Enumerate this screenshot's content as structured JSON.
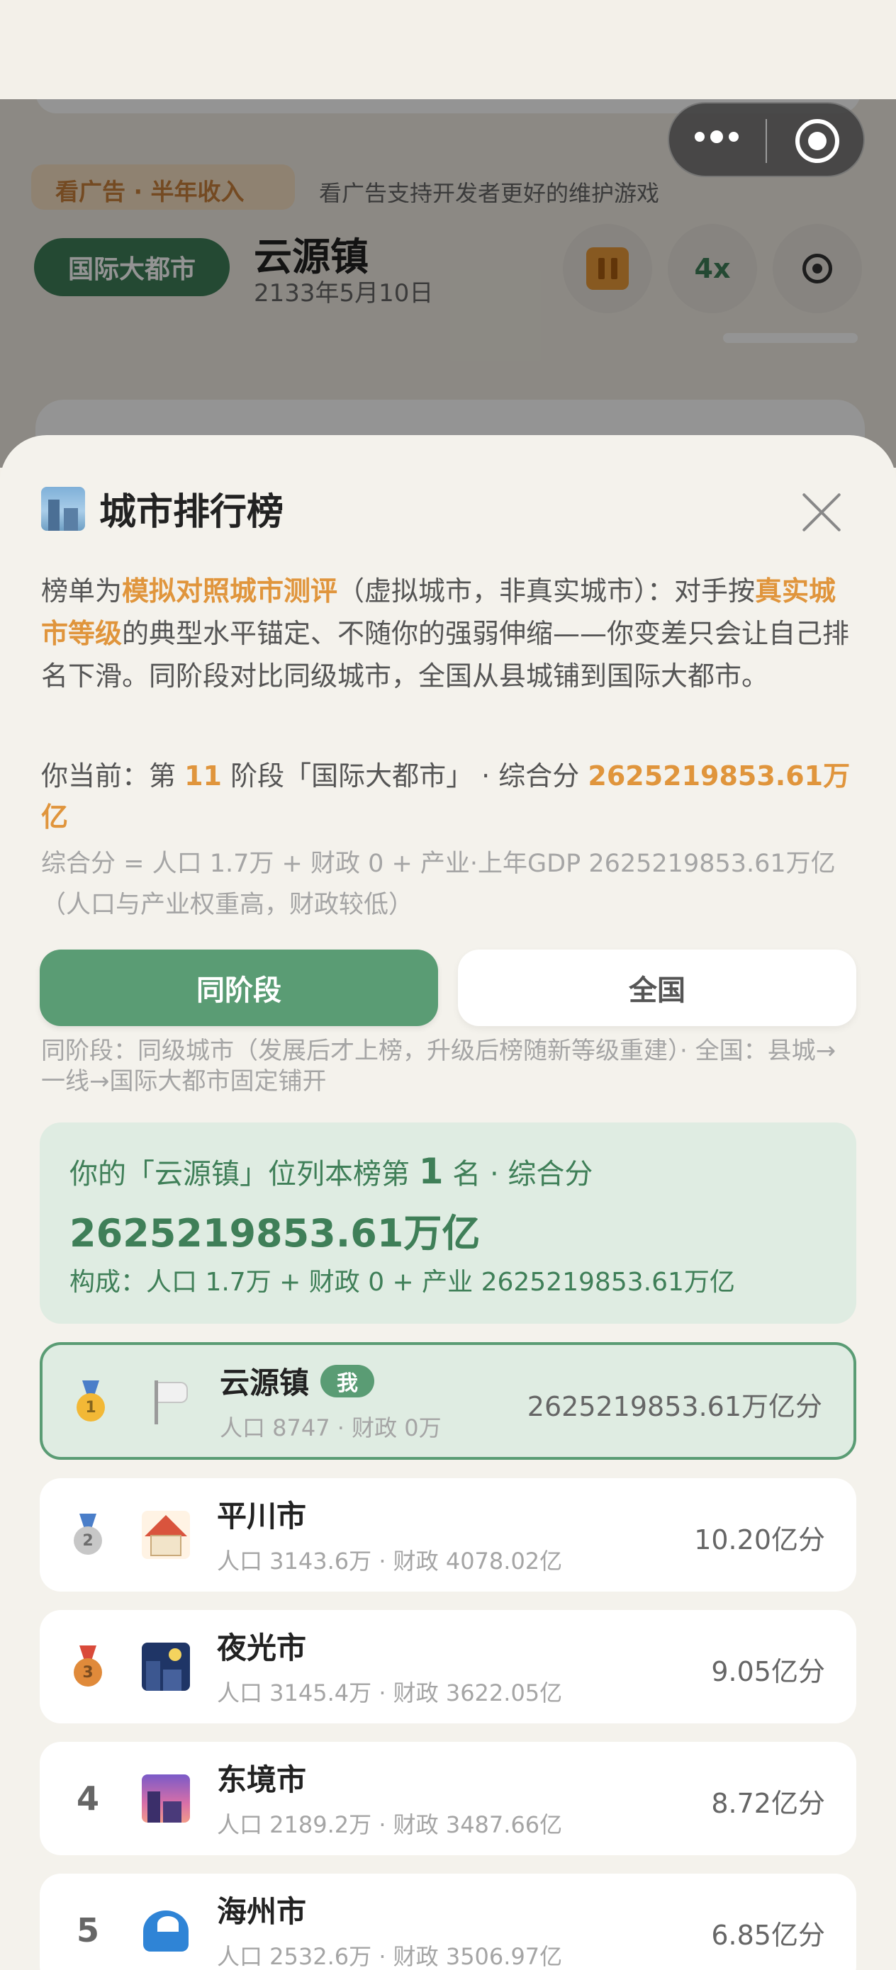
{
  "colors": {
    "accent_green": "#5a9c74",
    "dark_green": "#3f7f58",
    "highlight_orange": "#e0953c",
    "sheet_bg": "#f4f2ec"
  },
  "background": {
    "ad_label": "看广告 · 半年收入",
    "ad_hint": "看广告支持开发者更好的维护游戏",
    "level_badge": "国际大都市",
    "town_name": "云源镇",
    "date": "2133年5月10日",
    "speed": "4x",
    "pause_icon": "pause-icon",
    "settings_icon": "gear-icon"
  },
  "capsule": {
    "more_icon": "more-dots-icon",
    "close_icon": "target-circle-icon"
  },
  "sheet": {
    "icon": "cityscape-icon",
    "title": "城市排行榜",
    "intro": {
      "p1": "榜单为",
      "h1": "模拟对照城市测评",
      "p2": "（虚拟城市，非真实城市）：对手按",
      "h2": "真实城市等级",
      "p3": "的典型水平锚定、不随你的强弱伸缩——你变差只会让自己排名下滑。同阶段对比同级城市，全国从县城铺到国际大都市。"
    },
    "current": {
      "prefix": "你当前：第 ",
      "stage_num": "11",
      "mid": " 阶段「国际大都市」 · 综合分 ",
      "score": "2625219853.61万亿"
    },
    "formula_1": "综合分 = 人口 1.7万 + 财政 0 + 产业·上年GDP 2625219853.61万亿",
    "formula_2": "（人口与产业权重高，财政较低）",
    "tabs": {
      "stage": "同阶段",
      "nation": "全国"
    },
    "tab_hint": "同阶段：同级城市（发展后才上榜，升级后榜随新等级重建）· 全国：县城→一线→国际大都市固定铺开",
    "summary": {
      "prefix": "你的「云源镇」位列本榜第 ",
      "rank": "1",
      "suffix": " 名 · 综合分",
      "score": "2625219853.61万亿",
      "composition": "构成：人口 1.7万 + 财政 0 + 产业 2625219853.61万亿"
    },
    "rows": [
      {
        "rank": "1",
        "medal": "gold-medal-icon",
        "icon": "white-flag-icon",
        "name": "云源镇",
        "me_tag": "我",
        "stats": "人口 8747 · 财政 0万",
        "score": "2625219853.61万亿分"
      },
      {
        "rank": "2",
        "medal": "silver-medal-icon",
        "icon": "house-icon",
        "name": "平川市",
        "stats": "人口 3143.6万 · 财政 4078.02亿",
        "score": "10.20亿分"
      },
      {
        "rank": "3",
        "medal": "bronze-medal-icon",
        "icon": "night-city-icon",
        "name": "夜光市",
        "stats": "人口 3145.4万 · 财政 3622.05亿",
        "score": "9.05亿分"
      },
      {
        "rank": "4",
        "icon": "dusk-city-icon",
        "name": "东境市",
        "stats": "人口 2189.2万 · 财政 3487.66亿",
        "score": "8.72亿分"
      },
      {
        "rank": "5",
        "icon": "wave-icon",
        "name": "海州市",
        "stats": "人口 2532.6万 · 财政 3506.97亿",
        "score": "6.85亿分"
      }
    ]
  }
}
